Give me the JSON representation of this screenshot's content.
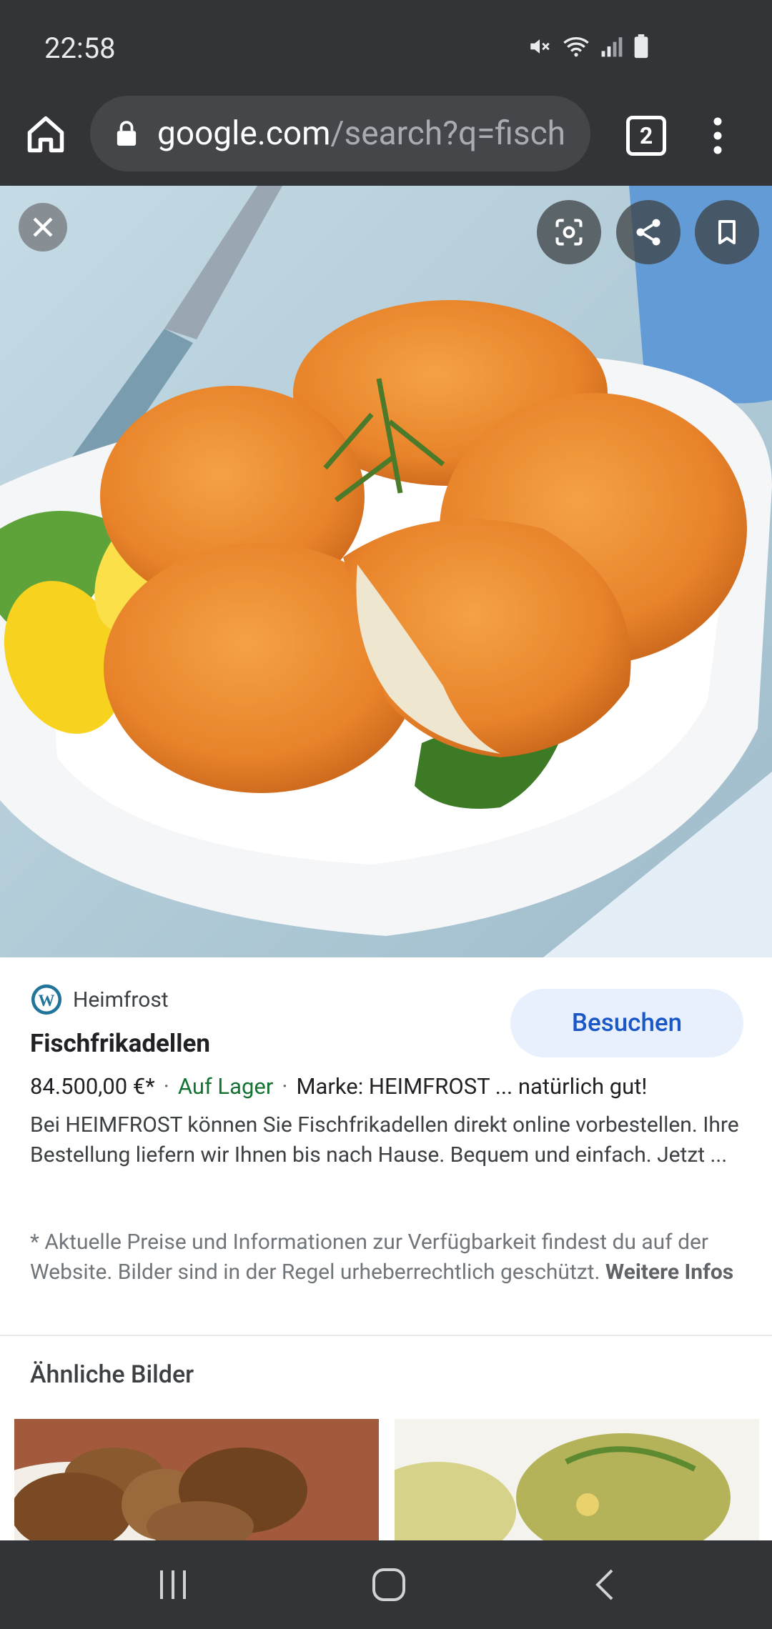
{
  "status_bar": {
    "time": "22:58",
    "icons": [
      "mute-icon",
      "wifi-icon",
      "signal-icon",
      "battery-icon"
    ]
  },
  "browser": {
    "url_host": "google.com",
    "url_path": "/search?q=fisch",
    "tab_count": "2"
  },
  "result": {
    "source": "Heimfrost",
    "visit_label": "Besuchen",
    "title": "Fischfrikadellen",
    "price": "84.500,00 €*",
    "availability": "Auf Lager",
    "brand_info": "Marke: HEIMFROST ... natürlich gut!",
    "description": "Bei HEIMFROST können Sie Fischfrikadellen direkt online vorbestellen. Ihre Bestellung liefern wir Ihnen bis nach Hause. Bequem und einfach. Jetzt ...",
    "disclaimer": "* Aktuelle Preise und Informationen zur Verfügbarkeit findest du auf der Website. Bilder sind in der Regel urheberrechtlich geschützt.",
    "more_info_label": "Weitere Infos"
  },
  "similar": {
    "heading": "Ähnliche Bilder"
  },
  "colors": {
    "chrome_dark": "#323437",
    "link_blue": "#1a57c7",
    "stock_green": "#137333",
    "visit_bg": "#e8f0fe"
  }
}
